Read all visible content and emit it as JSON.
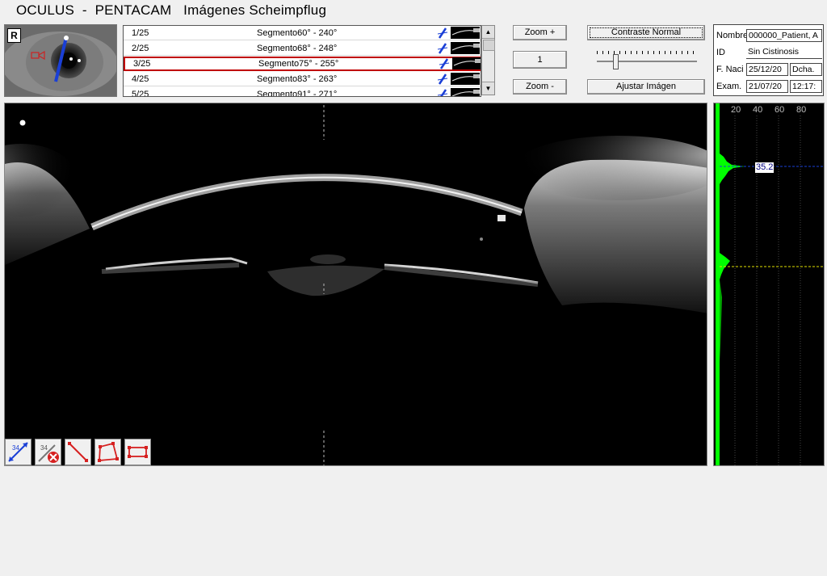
{
  "window": {
    "title": "OCULUS  -  PENTACAM   Imágenes Scheimpflug"
  },
  "eye_thumbnail": {
    "eye_label": "R"
  },
  "segments": [
    {
      "num": "1/25",
      "name": "Segmento60° - 240°",
      "selected": false
    },
    {
      "num": "2/25",
      "name": "Segmento68° - 248°",
      "selected": false
    },
    {
      "num": "3/25",
      "name": "Segmento75° - 255°",
      "selected": true
    },
    {
      "num": "4/25",
      "name": "Segmento83° - 263°",
      "selected": false
    },
    {
      "num": "5/25",
      "name": "Segmento91° - 271°",
      "selected": false
    }
  ],
  "zoom": {
    "zoom_in_label": "Zoom +",
    "zoom_level": "1",
    "zoom_out_label": "Zoom -"
  },
  "image_controls": {
    "contrast_label": "Contraste Normal",
    "adjust_label": "Ajustar Imágen",
    "contrast_slider_value": 0.2
  },
  "patient": {
    "name_label": "Nombre",
    "name_value": "000000_Patient, A",
    "id_label": "ID",
    "id_value": "Sin Cistinosis",
    "dob_label": "F. Naci",
    "dob_value": "25/12/20",
    "eye_value": "Dcha.",
    "exam_label": "Exam.",
    "exam_date": "21/07/20",
    "exam_time": "12:17:"
  },
  "histogram": {
    "ticks": [
      "20",
      "40",
      "60",
      "80"
    ],
    "value_label": "35.2"
  },
  "colors": {
    "selection_border": "#c00000",
    "histogram_green": "#00ff00",
    "axis_blue": "#1a3fd6"
  }
}
